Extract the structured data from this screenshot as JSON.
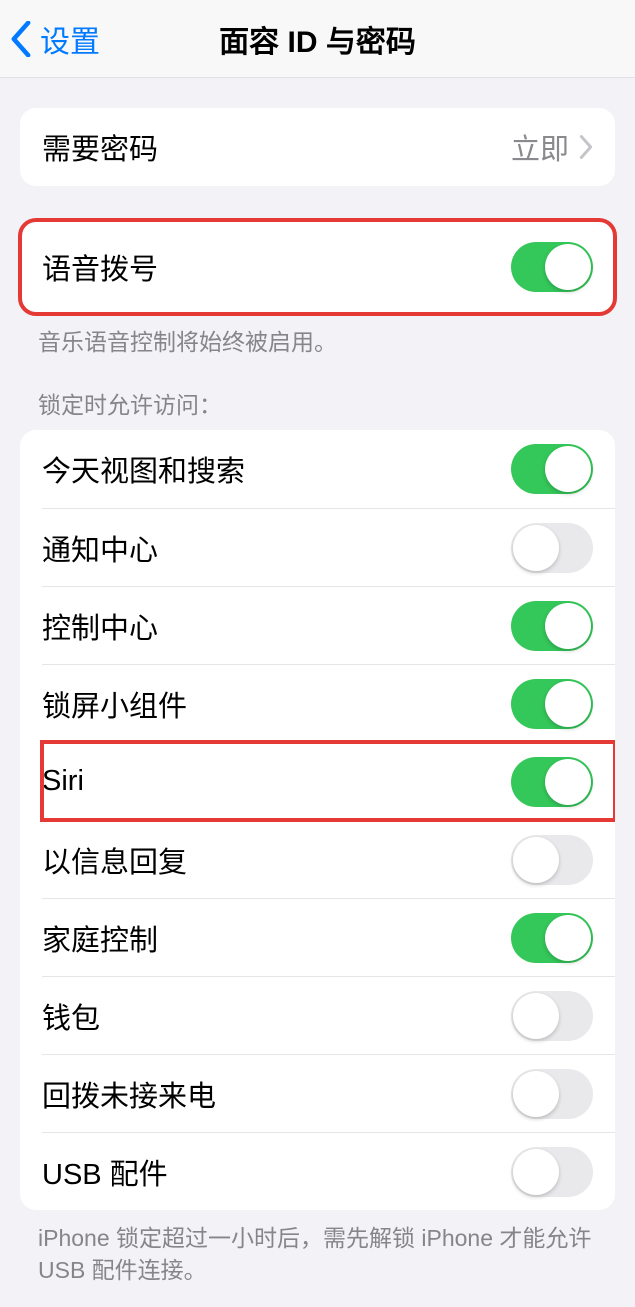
{
  "nav": {
    "back_label": "设置",
    "title": "面容 ID 与密码"
  },
  "passcode_group": {
    "require_label": "需要密码",
    "require_value": "立即"
  },
  "voice_group": {
    "voice_dial_label": "语音拨号",
    "voice_dial_on": true,
    "footer": "音乐语音控制将始终被启用。"
  },
  "locked_section": {
    "header": "锁定时允许访问：",
    "items": [
      {
        "label": "今天视图和搜索",
        "on": true
      },
      {
        "label": "通知中心",
        "on": false
      },
      {
        "label": "控制中心",
        "on": true
      },
      {
        "label": "锁屏小组件",
        "on": true
      },
      {
        "label": "Siri",
        "on": true
      },
      {
        "label": "以信息回复",
        "on": false
      },
      {
        "label": "家庭控制",
        "on": true
      },
      {
        "label": "钱包",
        "on": false
      },
      {
        "label": "回拨未接来电",
        "on": false
      },
      {
        "label": "USB 配件",
        "on": false
      }
    ],
    "footer": "iPhone 锁定超过一小时后，需先解锁 iPhone 才能允许 USB 配件连接。"
  }
}
